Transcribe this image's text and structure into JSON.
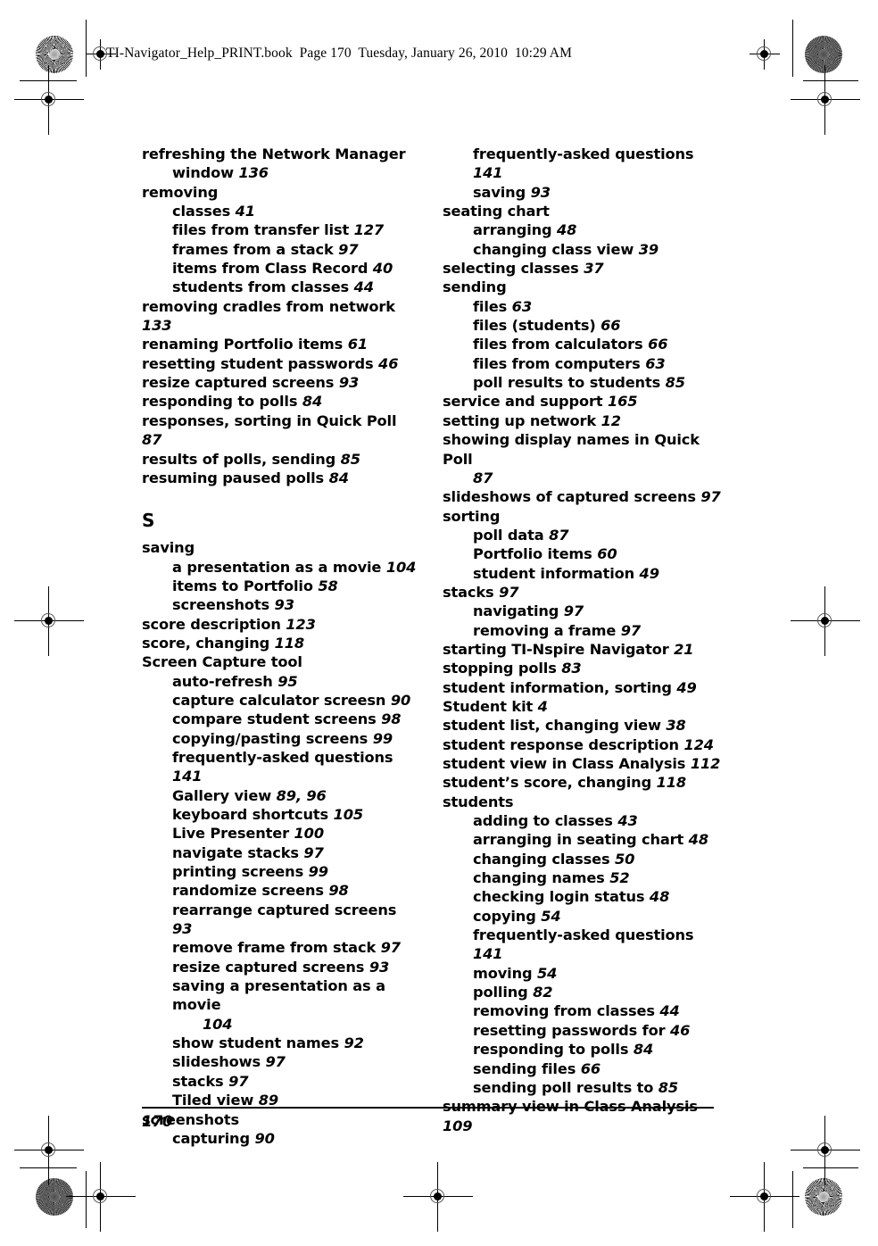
{
  "header": {
    "book_line": "TI-Navigator_Help_PRINT.book  Page 170  Tuesday, January 26, 2010  10:29 AM"
  },
  "footer": {
    "page_number": "170"
  },
  "index": {
    "left_column": [
      {
        "level": 1,
        "text": "refreshing the Network Manager",
        "continuation": "window ",
        "page": "136"
      },
      {
        "level": 1,
        "text": "removing",
        "page": ""
      },
      {
        "level": 2,
        "text": "classes ",
        "page": "41"
      },
      {
        "level": 2,
        "text": "files from transfer list ",
        "page": "127"
      },
      {
        "level": 2,
        "text": "frames from a stack ",
        "page": "97"
      },
      {
        "level": 2,
        "text": "items from Class Record ",
        "page": "40"
      },
      {
        "level": 2,
        "text": "students from classes ",
        "page": "44"
      },
      {
        "level": 1,
        "text": "removing cradles from network ",
        "page": "133"
      },
      {
        "level": 1,
        "text": "renaming Portfolio items ",
        "page": "61"
      },
      {
        "level": 1,
        "text": "resetting student passwords ",
        "page": "46"
      },
      {
        "level": 1,
        "text": "resize captured screens ",
        "page": "93"
      },
      {
        "level": 1,
        "text": "responding to polls ",
        "page": "84"
      },
      {
        "level": 1,
        "text": "responses, sorting in Quick Poll ",
        "page": "87"
      },
      {
        "level": 1,
        "text": "results of polls, sending ",
        "page": "85"
      },
      {
        "level": 1,
        "text": "resuming paused polls ",
        "page": "84"
      },
      {
        "letter": "S"
      },
      {
        "level": 1,
        "text": "saving",
        "page": ""
      },
      {
        "level": 2,
        "text": "a presentation as a movie ",
        "page": "104"
      },
      {
        "level": 2,
        "text": "items to Portfolio ",
        "page": "58"
      },
      {
        "level": 2,
        "text": "screenshots ",
        "page": "93"
      },
      {
        "level": 1,
        "text": "score description ",
        "page": "123"
      },
      {
        "level": 1,
        "text": "score, changing ",
        "page": "118"
      },
      {
        "level": 1,
        "text": "Screen Capture tool",
        "page": ""
      },
      {
        "level": 2,
        "text": "auto-refresh ",
        "page": "95"
      },
      {
        "level": 2,
        "text": "capture calculator screesn ",
        "page": "90"
      },
      {
        "level": 2,
        "text": "compare student screens ",
        "page": "98"
      },
      {
        "level": 2,
        "text": "copying/pasting screens ",
        "page": "99"
      },
      {
        "level": 2,
        "text": "frequently-asked questions ",
        "page": "141"
      },
      {
        "level": 2,
        "text": "Gallery view ",
        "page": "89, 96"
      },
      {
        "level": 2,
        "text": "keyboard shortcuts ",
        "page": "105"
      },
      {
        "level": 2,
        "text": "Live Presenter ",
        "page": "100"
      },
      {
        "level": 2,
        "text": "navigate stacks ",
        "page": "97"
      },
      {
        "level": 2,
        "text": "printing screens ",
        "page": "99"
      },
      {
        "level": 2,
        "text": "randomize screens ",
        "page": "98"
      },
      {
        "level": 2,
        "text": "rearrange captured screens ",
        "page": "93"
      },
      {
        "level": 2,
        "text": "remove frame from stack ",
        "page": "97"
      },
      {
        "level": 2,
        "text": "resize captured screens ",
        "page": "93"
      },
      {
        "level": 2,
        "text": "saving a presentation as a movie",
        "continuation": "",
        "page": "104"
      },
      {
        "level": 2,
        "text": "show student names ",
        "page": "92"
      },
      {
        "level": 2,
        "text": "slideshows ",
        "page": "97"
      },
      {
        "level": 2,
        "text": "stacks ",
        "page": "97"
      },
      {
        "level": 2,
        "text": "Tiled view ",
        "page": "89"
      },
      {
        "level": 1,
        "text": "screenshots",
        "page": ""
      },
      {
        "level": 2,
        "text": "capturing ",
        "page": "90"
      }
    ],
    "right_column": [
      {
        "level": 2,
        "text": "frequently-asked questions ",
        "page": "141"
      },
      {
        "level": 2,
        "text": "saving ",
        "page": "93"
      },
      {
        "level": 1,
        "text": "seating chart",
        "page": ""
      },
      {
        "level": 2,
        "text": "arranging ",
        "page": "48"
      },
      {
        "level": 2,
        "text": "changing class view ",
        "page": "39"
      },
      {
        "level": 1,
        "text": "selecting classes ",
        "page": "37"
      },
      {
        "level": 1,
        "text": "sending",
        "page": ""
      },
      {
        "level": 2,
        "text": "files ",
        "page": "63"
      },
      {
        "level": 2,
        "text": "files (students) ",
        "page": "66"
      },
      {
        "level": 2,
        "text": "files from calculators ",
        "page": "66"
      },
      {
        "level": 2,
        "text": "files from computers ",
        "page": "63"
      },
      {
        "level": 2,
        "text": "poll results to students ",
        "page": "85"
      },
      {
        "level": 1,
        "text": "service and support ",
        "page": "165"
      },
      {
        "level": 1,
        "text": "setting up network ",
        "page": "12"
      },
      {
        "level": 1,
        "text": "showing display names in Quick Poll",
        "continuation": "",
        "page": "87"
      },
      {
        "level": 1,
        "text": "slideshows of captured screens ",
        "page": "97"
      },
      {
        "level": 1,
        "text": "sorting",
        "page": ""
      },
      {
        "level": 2,
        "text": "poll data ",
        "page": "87"
      },
      {
        "level": 2,
        "text": "Portfolio items ",
        "page": "60"
      },
      {
        "level": 2,
        "text": "student information ",
        "page": "49"
      },
      {
        "level": 1,
        "text": "stacks ",
        "page": "97"
      },
      {
        "level": 2,
        "text": "navigating ",
        "page": "97"
      },
      {
        "level": 2,
        "text": "removing a frame ",
        "page": "97"
      },
      {
        "level": 1,
        "text": "starting TI-Nspire Navigator ",
        "page": "21"
      },
      {
        "level": 1,
        "text": "stopping polls ",
        "page": "83"
      },
      {
        "level": 1,
        "text": "student information, sorting ",
        "page": "49"
      },
      {
        "level": 1,
        "text": "Student kit ",
        "page": "4"
      },
      {
        "level": 1,
        "text": "student list, changing view ",
        "page": "38"
      },
      {
        "level": 1,
        "text": "student response description ",
        "page": "124"
      },
      {
        "level": 1,
        "text": "student view in Class Analysis ",
        "page": "112"
      },
      {
        "level": 1,
        "text": "student’s score, changing ",
        "page": "118"
      },
      {
        "level": 1,
        "text": "students",
        "page": ""
      },
      {
        "level": 2,
        "text": "adding to classes ",
        "page": "43"
      },
      {
        "level": 2,
        "text": "arranging in seating chart ",
        "page": "48"
      },
      {
        "level": 2,
        "text": "changing classes ",
        "page": "50"
      },
      {
        "level": 2,
        "text": "changing names ",
        "page": "52"
      },
      {
        "level": 2,
        "text": "checking login status ",
        "page": "48"
      },
      {
        "level": 2,
        "text": "copying ",
        "page": "54"
      },
      {
        "level": 2,
        "text": "frequently-asked questions ",
        "page": "141"
      },
      {
        "level": 2,
        "text": "moving ",
        "page": "54"
      },
      {
        "level": 2,
        "text": "polling ",
        "page": "82"
      },
      {
        "level": 2,
        "text": "removing from classes ",
        "page": "44"
      },
      {
        "level": 2,
        "text": "resetting passwords for ",
        "page": "46"
      },
      {
        "level": 2,
        "text": "responding to polls ",
        "page": "84"
      },
      {
        "level": 2,
        "text": "sending files ",
        "page": "66"
      },
      {
        "level": 2,
        "text": "sending poll results to ",
        "page": "85"
      },
      {
        "level": 1,
        "text": "summary view in Class Analysis ",
        "page": "109"
      }
    ]
  }
}
